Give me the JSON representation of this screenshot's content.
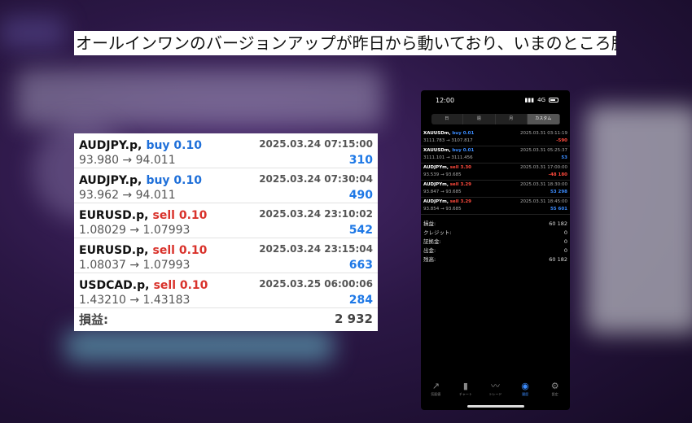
{
  "caption": "オールインワンのバージョンアップが昨日から動いており、いまのところ勝ててます。",
  "trades": [
    {
      "symbol": "AUDJPY.p,",
      "side": "buy 0.10",
      "type": "buy",
      "datetime": "2025.03.24 07:15:00",
      "prices": "93.980 → 94.011",
      "profit": "310"
    },
    {
      "symbol": "AUDJPY.p,",
      "side": "buy 0.10",
      "type": "buy",
      "datetime": "2025.03.24 07:30:04",
      "prices": "93.962 → 94.011",
      "profit": "490"
    },
    {
      "symbol": "EURUSD.p,",
      "side": "sell 0.10",
      "type": "sell",
      "datetime": "2025.03.24 23:10:02",
      "prices": "1.08029 → 1.07993",
      "profit": "542"
    },
    {
      "symbol": "EURUSD.p,",
      "side": "sell 0.10",
      "type": "sell",
      "datetime": "2025.03.24 23:15:04",
      "prices": "1.08037 → 1.07993",
      "profit": "663"
    },
    {
      "symbol": "USDCAD.p,",
      "side": "sell 0.10",
      "type": "sell",
      "datetime": "2025.03.25 06:00:06",
      "prices": "1.43210 → 1.43183",
      "profit": "284"
    }
  ],
  "total": {
    "label": "損益:",
    "value": "2 932"
  },
  "phone": {
    "time": "12:00",
    "network": "4G",
    "segments": [
      {
        "label": "日",
        "active": false
      },
      {
        "label": "週",
        "active": false
      },
      {
        "label": "月",
        "active": false
      },
      {
        "label": "カスタム",
        "active": true
      }
    ],
    "trades": [
      {
        "symbol": "XAUUSDm,",
        "side": "buy 0.01",
        "type": "buy",
        "datetime": "2025.03.31 03:11:19",
        "prices": "3111.783 → 3107.817",
        "profit": "-590",
        "sign": "neg"
      },
      {
        "symbol": "XAUUSDm,",
        "side": "buy 0.01",
        "type": "buy",
        "datetime": "2025.03.31 05:25:37",
        "prices": "3111.101 → 3111.456",
        "profit": "53",
        "sign": "pos"
      },
      {
        "symbol": "AUDJPYm,",
        "side": "sell 3.30",
        "type": "sell",
        "datetime": "2025.03.31 17:00:00",
        "prices": "93.539 → 93.685",
        "profit": "-48 180",
        "sign": "neg"
      },
      {
        "symbol": "AUDJPYm,",
        "side": "sell 3.29",
        "type": "sell",
        "datetime": "2025.03.31 18:30:00",
        "prices": "93.847 → 93.685",
        "profit": "53 298",
        "sign": "pos"
      },
      {
        "symbol": "AUDJPYm,",
        "side": "sell 3.29",
        "type": "sell",
        "datetime": "2025.03.31 18:45:00",
        "prices": "93.854 → 93.685",
        "profit": "55 601",
        "sign": "pos"
      }
    ],
    "summary": [
      {
        "label": "損益:",
        "value": "60 182"
      },
      {
        "label": "クレジット:",
        "value": "0"
      },
      {
        "label": "証拠金:",
        "value": "0"
      },
      {
        "label": "出金:",
        "value": "0"
      },
      {
        "label": "残高:",
        "value": "60 182"
      }
    ],
    "tabs": [
      {
        "icon": "quotes-icon",
        "glyph": "↗",
        "label": "気配値",
        "active": false
      },
      {
        "icon": "chart-icon",
        "glyph": "▮",
        "label": "チャート",
        "active": false
      },
      {
        "icon": "trade-icon",
        "glyph": "〰",
        "label": "トレード",
        "active": false
      },
      {
        "icon": "history-icon",
        "glyph": "◉",
        "label": "履歴",
        "active": true
      },
      {
        "icon": "settings-icon",
        "glyph": "⚙",
        "label": "設定",
        "active": false
      }
    ]
  }
}
